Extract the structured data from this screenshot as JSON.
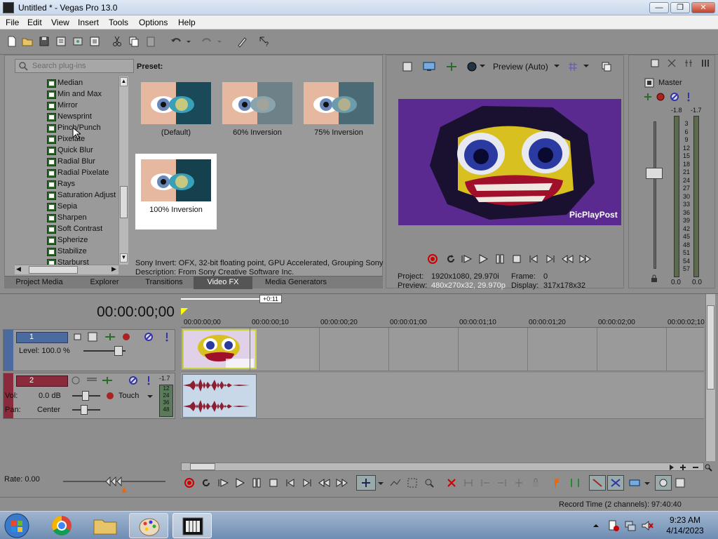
{
  "window": {
    "title": "Untitled * - Vegas Pro 13.0"
  },
  "menu": [
    "File",
    "Edit",
    "View",
    "Insert",
    "Tools",
    "Options",
    "Help"
  ],
  "plugins": {
    "search_placeholder": "Search plug-ins",
    "items": [
      "Median",
      "Min and Max",
      "Mirror",
      "Newsprint",
      "Pinch/Punch",
      "Pixelate",
      "Quick Blur",
      "Radial Blur",
      "Radial Pixelate",
      "Rays",
      "Saturation Adjust",
      "Sepia",
      "Sharpen",
      "Soft Contrast",
      "Spherize",
      "Stabilize",
      "Starburst"
    ],
    "preset_label": "Preset:",
    "presets": [
      "(Default)",
      "60% Inversion",
      "75% Inversion",
      "100% Inversion"
    ],
    "selected_preset": "100% Inversion",
    "description_line1": "Sony Invert: OFX, 32-bit floating point, GPU Accelerated, Grouping Sony",
    "description_line2": "Description: From Sony Creative Software Inc."
  },
  "tabs": [
    "Project Media",
    "Explorer",
    "Transitions",
    "Video FX",
    "Media Generators"
  ],
  "active_tab": "Video FX",
  "preview": {
    "mode": "Preview (Auto)",
    "watermark": "PicPlayPost",
    "project_label": "Project:",
    "project_value": "1920x1080, 29.970i",
    "frame_label": "Frame:",
    "frame_value": "0",
    "preview_label": "Preview:",
    "preview_value": "480x270x32, 29.970p",
    "display_label": "Display:",
    "display_value": "317x178x32"
  },
  "master": {
    "title": "Master",
    "left_peak": "-1.8",
    "right_peak": "-1.7",
    "scale": [
      "3",
      "6",
      "9",
      "12",
      "15",
      "18",
      "21",
      "24",
      "27",
      "30",
      "33",
      "36",
      "39",
      "42",
      "45",
      "48",
      "51",
      "54",
      "57"
    ],
    "left_value": "0.0",
    "right_value": "0.0"
  },
  "timeline": {
    "timecode": "00:00:00;00",
    "region_label": "+0:11",
    "ruler": [
      "00:00:00;00",
      "00:00:00;10",
      "00:00:00;20",
      "00:00:01;00",
      "00:00:01;10",
      "00:00:01;20",
      "00:00:02;00",
      "00:00:02;10"
    ],
    "video_track": {
      "number": "1",
      "level_label": "Level: 100.0 %"
    },
    "audio_track": {
      "number": "2",
      "vol_label": "Vol:",
      "vol_value": "0.0 dB",
      "pan_label": "Pan:",
      "pan_value": "Center",
      "automation": "Touch",
      "peak": "-1.7",
      "meter": [
        "12",
        "24",
        "36",
        "48"
      ]
    },
    "rate_label": "Rate: 0.00"
  },
  "status": {
    "record_time": "Record Time (2 channels): 97:40:40"
  },
  "taskbar": {
    "time": "9:23 AM",
    "date": "4/14/2023"
  },
  "colors": {
    "chrome": "#8e8e8e",
    "video_bg": "#5a2a90",
    "clip_border": "#c8d23c",
    "waveform": "#8a2030",
    "selection": "#ffffff"
  }
}
